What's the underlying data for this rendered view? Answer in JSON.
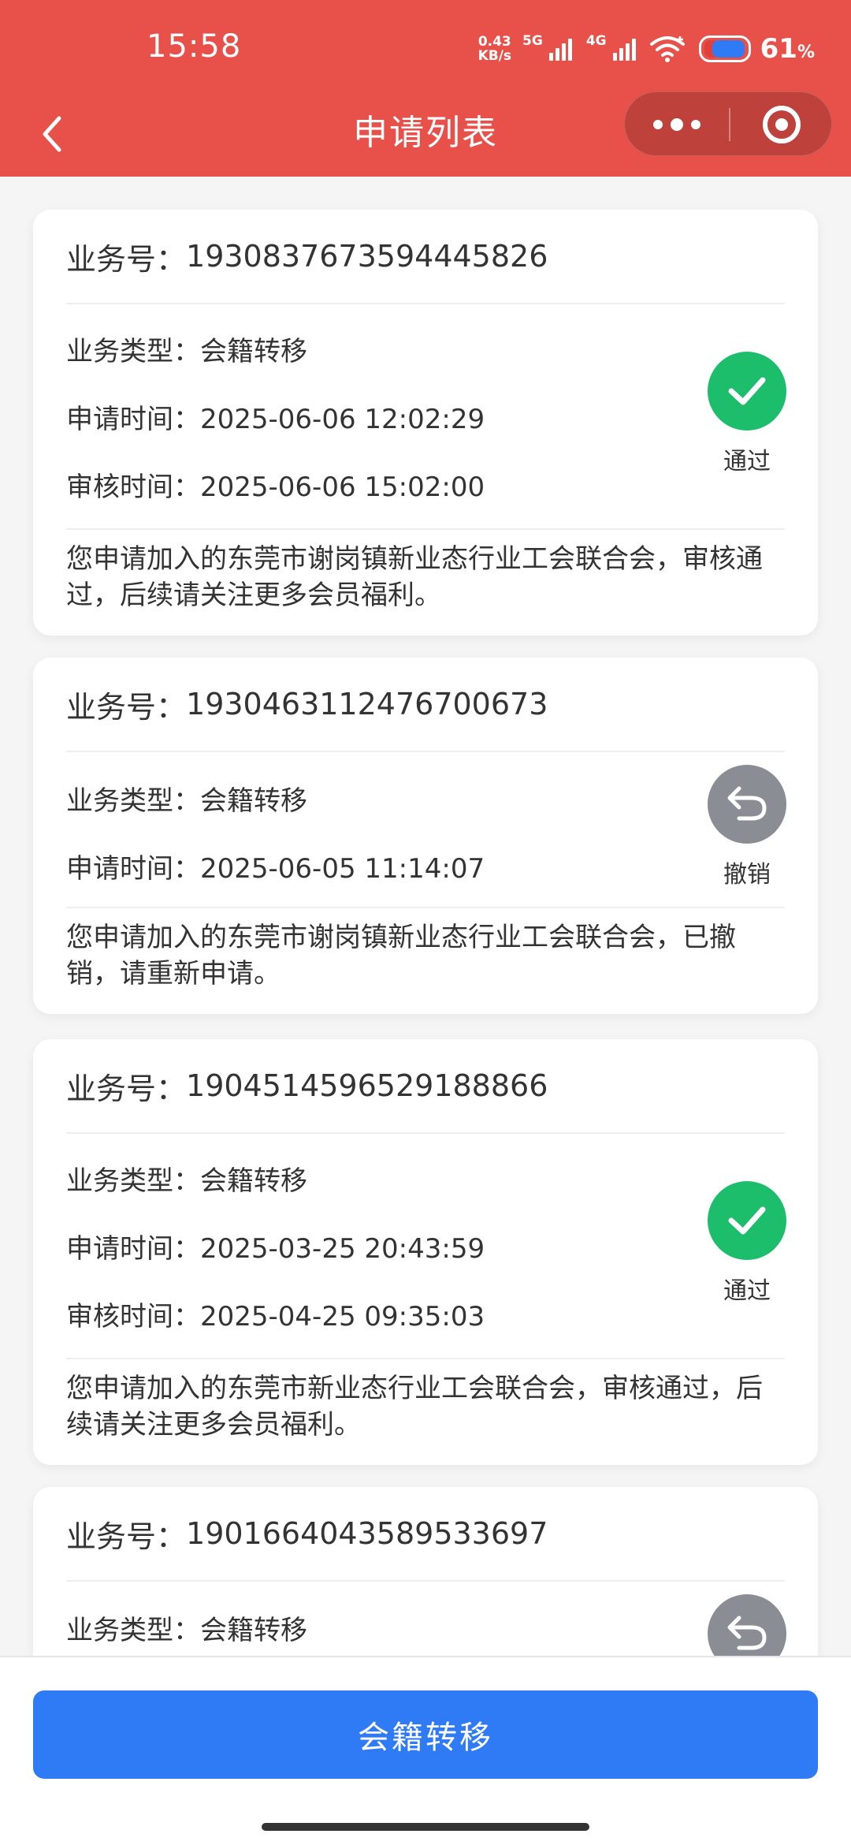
{
  "status_bar": {
    "time": "15:58",
    "net_speed_value": "0.43",
    "net_speed_unit": "KB/s",
    "sim1_label": "5G",
    "sim2_label": "4G",
    "battery_percent": "61",
    "battery_unit": "%"
  },
  "nav": {
    "title": "申请列表",
    "back_icon": "chevron-left-icon",
    "more_icon": "more-dots-icon",
    "close_icon": "target-circle-icon"
  },
  "labels": {
    "business_no": "业务号：",
    "business_type": "业务类型：",
    "apply_time": "申请时间：",
    "review_time": "审核时间："
  },
  "applications": [
    {
      "business_no": "1930837673594445826",
      "type": "会籍转移",
      "apply_time": "2025-06-06 12:02:29",
      "review_time": "2025-06-06 15:02:00",
      "status": "通过",
      "status_icon": "check-circle-icon",
      "message": "您申请加入的东莞市谢岗镇新业态行业工会联合会，审核通过，后续请关注更多会员福利。"
    },
    {
      "business_no": "1930463112476700673",
      "type": "会籍转移",
      "apply_time": "2025-06-05 11:14:07",
      "status": "撤销",
      "status_icon": "undo-circle-icon",
      "message": "您申请加入的东莞市谢岗镇新业态行业工会联合会，已撤销，请重新申请。"
    },
    {
      "business_no": "1904514596529188866",
      "type": "会籍转移",
      "apply_time": "2025-03-25 20:43:59",
      "review_time": "2025-04-25 09:35:03",
      "status": "通过",
      "status_icon": "check-circle-icon",
      "message": "您申请加入的东莞市新业态行业工会联合会，审核通过，后续请关注更多会员福利。"
    },
    {
      "business_no": "1901664043589533697",
      "type": "会籍转移",
      "status_icon": "undo-circle-icon"
    }
  ],
  "bottom": {
    "button_label": "会籍转移"
  },
  "colors": {
    "header_red": "#e8504a",
    "primary_blue": "#2f7bf5",
    "pass_green": "#1dbe6b",
    "revoke_gray": "#8a8d94"
  }
}
